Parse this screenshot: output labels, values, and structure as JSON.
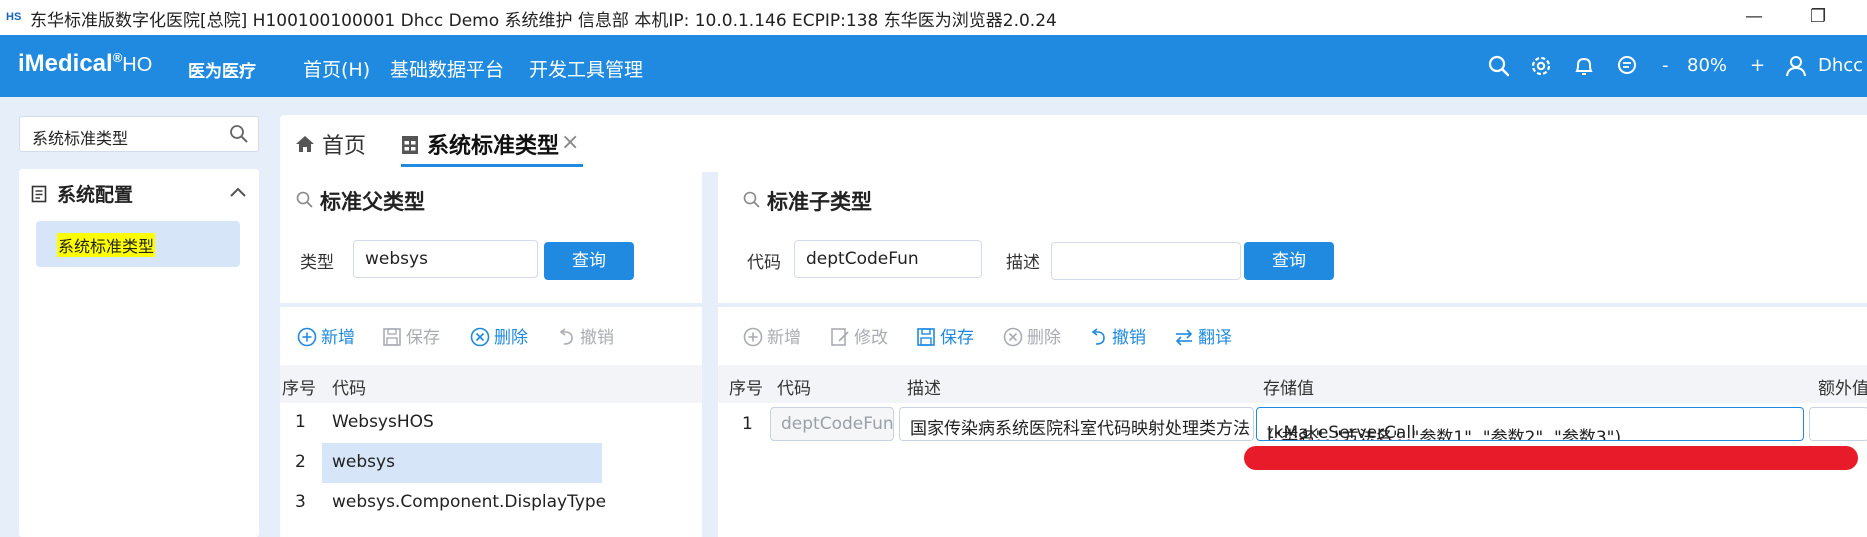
{
  "window": {
    "title": "东华标准版数字化医院[总院] H100100100001 Dhcc Demo 系统维护 信息部 本机IP: 10.0.1.146 ECPIP:138 东华医为浏览器2.0.24",
    "logo_text": "HS",
    "min_glyph": "—",
    "restore_glyph": "❐"
  },
  "header": {
    "brand": "iMedical",
    "brand_reg": "®",
    "brand_suffix": "HO",
    "brand_sub": "医为医疗",
    "menu": [
      "首页(H)",
      "基础数据平台",
      "开发工具管理"
    ],
    "icons": [
      "search-icon",
      "gear-icon",
      "bell-icon",
      "chat-icon"
    ],
    "zoom_minus": "-",
    "zoom": "80%",
    "zoom_plus": "+",
    "user": "Dhcc D"
  },
  "sidebar": {
    "search_value": "系统标准类型",
    "group_label": "系统配置",
    "item_label": "系统标准类型"
  },
  "tabs": {
    "home": "首页",
    "active": "系统标准类型",
    "close": "×"
  },
  "parent_panel": {
    "title": "标准父类型",
    "type_label": "类型",
    "type_value": "websys",
    "query": "查询",
    "toolbar": {
      "add": "新增",
      "save": "保存",
      "delete": "删除",
      "undo": "撤销"
    },
    "columns": {
      "seq": "序号",
      "code": "代码"
    },
    "rows": [
      {
        "seq": "1",
        "code": "WebsysHOS"
      },
      {
        "seq": "2",
        "code": "websys"
      },
      {
        "seq": "3",
        "code": "websys.Component.DisplayType"
      }
    ],
    "selected_row": 2
  },
  "child_panel": {
    "title": "标准子类型",
    "code_label": "代码",
    "code_value": "deptCodeFun",
    "desc_label": "描述",
    "desc_value": "",
    "query": "查询",
    "toolbar": {
      "add": "新增",
      "edit": "修改",
      "save": "保存",
      "delete": "删除",
      "undo": "撤销",
      "translate": "翻译"
    },
    "columns": {
      "seq": "序号",
      "code": "代码",
      "desc": "描述",
      "value": "存储值",
      "extra": "额外值"
    },
    "rows": [
      {
        "seq": "1",
        "code": "deptCodeFun",
        "desc": "国家传染病系统医院科室代码映射处理类方法",
        "value_underlined": "tkMakeServerCall",
        "value_rest": "(\"类名\", \"方法名\", \"参数1\", \"参数2\", \"参数3\")"
      }
    ]
  },
  "colors": {
    "accent": "#1f8ae0",
    "highlight": "#ffff00",
    "annotation": "#e81b2a"
  }
}
